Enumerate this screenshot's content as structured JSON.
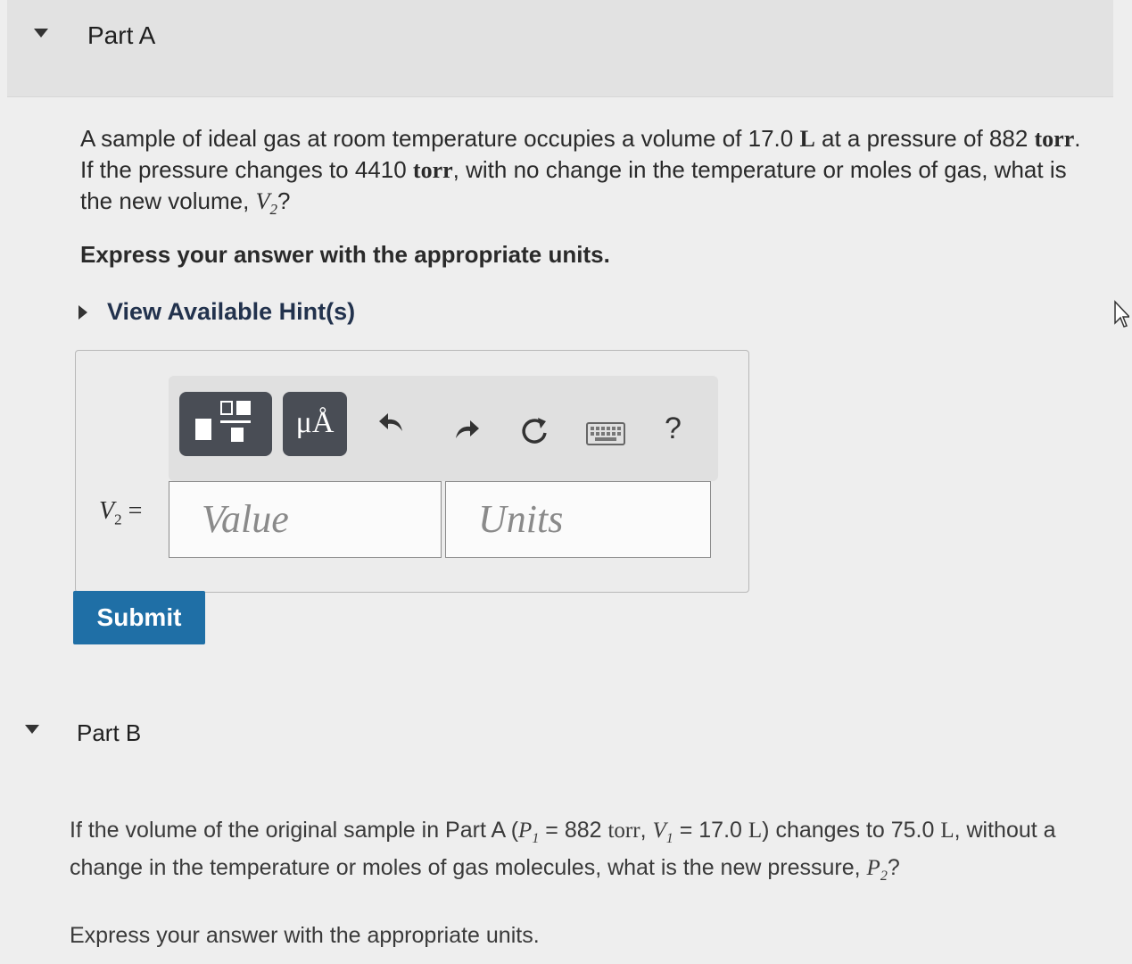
{
  "part_a": {
    "title": "Part A",
    "question": {
      "t1": "A sample of ideal gas at room temperature occupies a volume of 17.0 ",
      "u_l": "L",
      "t2": " at a pressure of 882 ",
      "u_torr": "torr",
      "t3": ". If the pressure changes to 4410 ",
      "u_torr2": "torr",
      "t4": ", with no change in the temperature or moles of gas, what is the new volume, ",
      "var": "V",
      "sub": "2",
      "t5": "?"
    },
    "express": "Express your answer with the appropriate units.",
    "hint_link": "View Available Hint(s)",
    "toolbar": {
      "units_button": "μÅ",
      "help": "?"
    },
    "answer_label": {
      "var": "V",
      "sub": "2",
      "eq": " ="
    },
    "value_placeholder": "Value",
    "units_placeholder": "Units",
    "submit": "Submit"
  },
  "part_b": {
    "title": "Part B",
    "question": {
      "t1": "If the volume of the original sample in Part A (",
      "p": "P",
      "p_sub": "1",
      "t2": " = 882 ",
      "u_torr": "torr",
      "t3": ", ",
      "v": "V",
      "v_sub": "1",
      "t4": " = 17.0 ",
      "u_l": "L",
      "t5": ") changes to 75.0 ",
      "u_l2": "L",
      "t6": ", without a change in the temperature or moles of gas molecules, what is the new pressure, ",
      "p2": "P",
      "p2_sub": "2",
      "t7": "?"
    },
    "express": "Express your answer with the appropriate units."
  },
  "icons": {
    "collapse_a": "caret-down-icon",
    "collapse_b": "caret-down-icon",
    "hint": "caret-right-icon",
    "templates": "templates-icon",
    "undo": "undo-icon",
    "redo": "redo-icon",
    "reset": "reset-icon",
    "keyboard": "keyboard-icon",
    "help": "help-icon"
  },
  "colors": {
    "submit": "#1f6fa6",
    "toolbar_dark": "#494d55",
    "hint_text": "#22324d"
  }
}
